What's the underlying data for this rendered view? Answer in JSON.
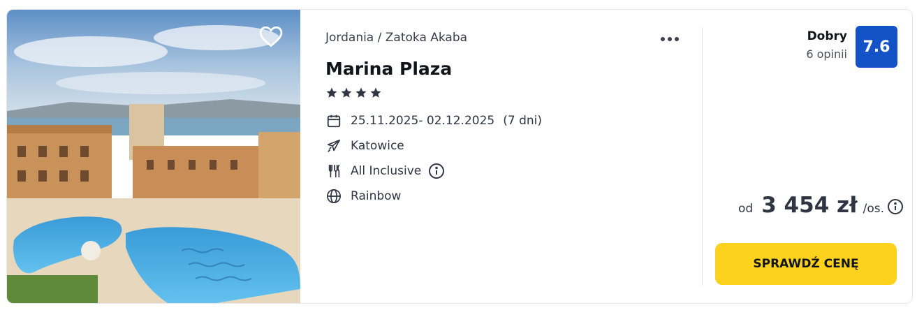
{
  "hotel": {
    "breadcrumb": "Jordania / Zatoka Akaba",
    "name": "Marina Plaza",
    "stars": 4,
    "dates": "25.11.2025- 02.12.2025",
    "duration": "(7 dni)",
    "departure": "Katowice",
    "board": "All Inclusive",
    "operator": "Rainbow"
  },
  "rating": {
    "label": "Dobry",
    "reviews": "6 opinii",
    "score": "7.6"
  },
  "price": {
    "prefix": "od",
    "amount": "3 454 zł",
    "suffix": "/os."
  },
  "cta": {
    "label": "SPRAWDŹ CENĘ"
  },
  "icons": {
    "favorite": "heart-icon",
    "more": "more-options-icon",
    "dates": "calendar-icon",
    "departure": "plane-icon",
    "board": "cutlery-icon",
    "operator": "globe-icon",
    "info": "info-icon"
  },
  "colors": {
    "score_bg": "#1452c8",
    "cta_bg": "#fcd21d",
    "text": "#2f3542"
  }
}
